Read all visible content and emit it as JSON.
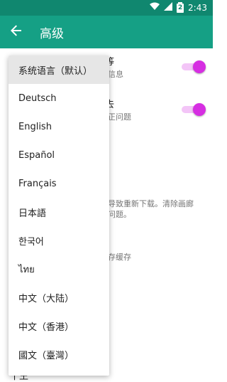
{
  "status_bar": {
    "time": "2:43",
    "battery_level": "2"
  },
  "app_bar": {
    "title": "高级",
    "back_icon": "arrow-back-icon"
  },
  "background_settings": {
    "item1_title_fragment": "等",
    "item1_sub_fragment": "信息",
    "item2_title_fragment": "去",
    "item2_sub_fragment": "正问题",
    "item3_line1": "导致重新下载。清除画廊",
    "item3_line2": "问题。",
    "item4_line1": "存缓存",
    "item5_fragment": "十王"
  },
  "colors": {
    "primary": "#15a085",
    "primary_dark": "#10876f",
    "accent": "#d62ee2"
  },
  "language_menu": {
    "items": [
      {
        "label": "系统语言（默认）"
      },
      {
        "label": "Deutsch"
      },
      {
        "label": "English"
      },
      {
        "label": "Español"
      },
      {
        "label": "Français"
      },
      {
        "label": "日本語"
      },
      {
        "label": "한국어"
      },
      {
        "label": "ไทย"
      },
      {
        "label": "中文（大陆）"
      },
      {
        "label": "中文（香港）"
      },
      {
        "label": "國文（臺灣）"
      }
    ]
  }
}
